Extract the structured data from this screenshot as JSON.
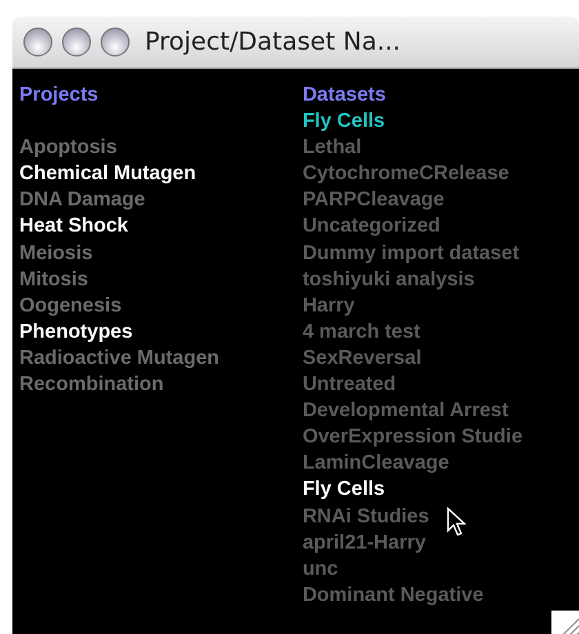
{
  "window": {
    "title": "Project/Dataset Na..."
  },
  "projects": {
    "heading": "Projects",
    "items": [
      {
        "label": "Apoptosis",
        "highlighted": false
      },
      {
        "label": "Chemical Mutagen",
        "highlighted": true
      },
      {
        "label": "DNA Damage",
        "highlighted": false
      },
      {
        "label": "Heat Shock",
        "highlighted": true
      },
      {
        "label": "Meiosis",
        "highlighted": false
      },
      {
        "label": "Mitosis",
        "highlighted": false
      },
      {
        "label": "Oogenesis",
        "highlighted": false
      },
      {
        "label": "Phenotypes",
        "highlighted": true
      },
      {
        "label": "Radioactive Mutagen",
        "highlighted": false
      },
      {
        "label": "Recombination",
        "highlighted": false
      }
    ]
  },
  "datasets": {
    "heading": "Datasets",
    "current": "Fly Cells",
    "items": [
      {
        "label": "Lethal",
        "highlighted": false
      },
      {
        "label": "CytochromeCRelease",
        "highlighted": false
      },
      {
        "label": "PARPCleavage",
        "highlighted": false
      },
      {
        "label": "Uncategorized",
        "highlighted": false
      },
      {
        "label": "Dummy import dataset",
        "highlighted": false
      },
      {
        "label": "toshiyuki analysis",
        "highlighted": false
      },
      {
        "label": "Harry",
        "highlighted": false
      },
      {
        "label": "4 march test",
        "highlighted": false
      },
      {
        "label": "SexReversal",
        "highlighted": false
      },
      {
        "label": "Untreated",
        "highlighted": false
      },
      {
        "label": "Developmental Arrest",
        "highlighted": false
      },
      {
        "label": "OverExpression Studie",
        "highlighted": false
      },
      {
        "label": "LaminCleavage",
        "highlighted": false
      },
      {
        "label": "Fly Cells",
        "highlighted": true
      },
      {
        "label": "RNAi Studies",
        "highlighted": false
      },
      {
        "label": "april21-Harry",
        "highlighted": false
      },
      {
        "label": "unc",
        "highlighted": false
      },
      {
        "label": "Dominant Negative",
        "highlighted": false
      }
    ]
  }
}
